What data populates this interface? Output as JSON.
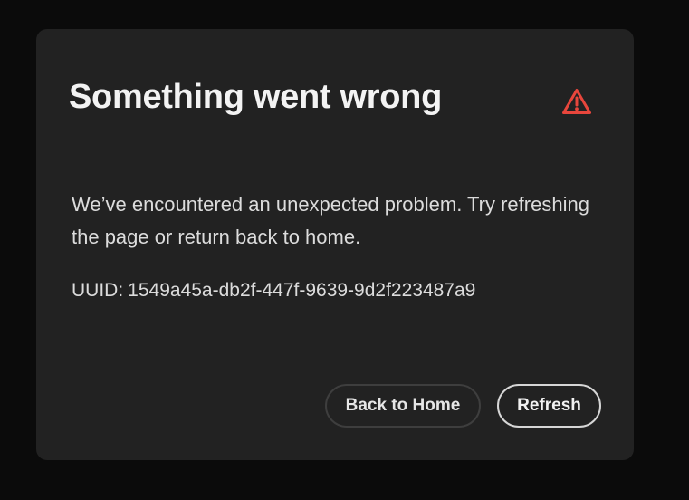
{
  "dialog": {
    "title": "Something went wrong",
    "icon": "alert-triangle-icon",
    "message": "We’ve encountered an unexpected problem. Try refreshing the page or return back to home.",
    "uuid_label": "UUID:",
    "uuid_value": "1549a45a-db2f-447f-9639-9d2f223487a9",
    "buttons": {
      "home_label": "Back to Home",
      "refresh_label": "Refresh"
    }
  },
  "colors": {
    "page_background": "#0b0b0b",
    "dialog_background": "#222222",
    "alert_icon": "#e8463c",
    "text_primary": "#f3f3f3"
  }
}
